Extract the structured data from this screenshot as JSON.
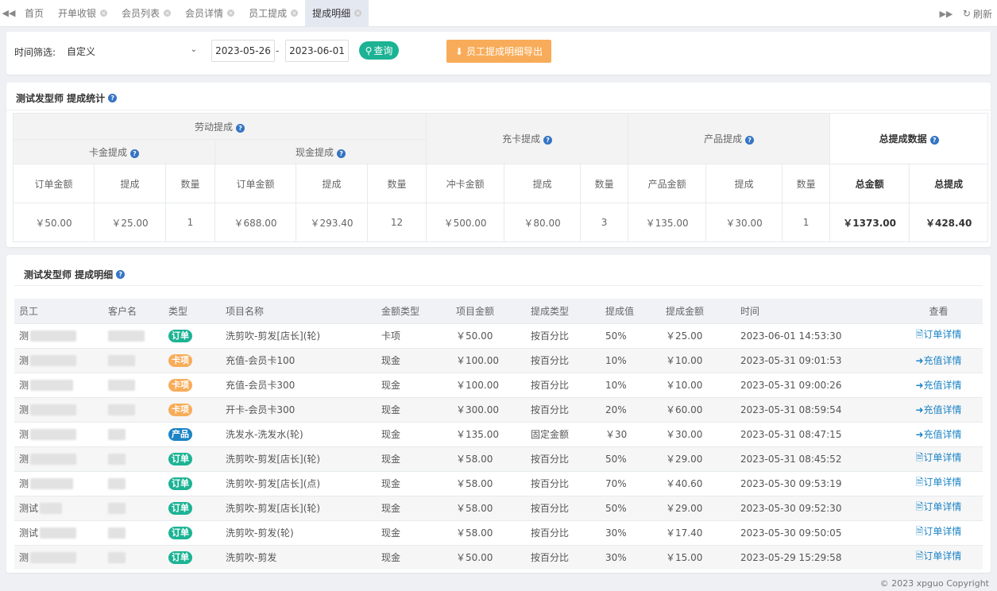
{
  "tabs": {
    "items": [
      {
        "label": "首页",
        "closable": false
      },
      {
        "label": "开单收银",
        "closable": true
      },
      {
        "label": "会员列表",
        "closable": true
      },
      {
        "label": "会员详情",
        "closable": true
      },
      {
        "label": "员工提成",
        "closable": true
      },
      {
        "label": "提成明细",
        "closable": true,
        "active": true
      }
    ],
    "refresh_label": "刷新"
  },
  "filter": {
    "label": "时间筛选:",
    "select_value": "自定义",
    "start_date": "2023-05-26",
    "separator": "-",
    "end_date": "2023-06-01",
    "query_label": "查询",
    "export_label": "员工提成明细导出"
  },
  "stats": {
    "title": "测试发型师 提成统计",
    "groups": {
      "labor": "劳动提成",
      "card_commission": "卡金提成",
      "cash_commission": "现金提成",
      "recharge": "充卡提成",
      "product": "产品提成",
      "total": "总提成数据"
    },
    "columns": [
      "订单金额",
      "提成",
      "数量",
      "订单金额",
      "提成",
      "数量",
      "冲卡金额",
      "提成",
      "数量",
      "产品金额",
      "提成",
      "数量",
      "总金额",
      "总提成"
    ],
    "values": [
      "￥50.00",
      "￥25.00",
      "1",
      "￥688.00",
      "￥293.40",
      "12",
      "￥500.00",
      "￥80.00",
      "3",
      "￥135.00",
      "￥30.00",
      "1",
      "￥1373.00",
      "￥428.40"
    ]
  },
  "detail": {
    "title": "测试发型师 提成明细",
    "headers": [
      "员工",
      "客户名",
      "类型",
      "项目名称",
      "金额类型",
      "项目金额",
      "提成类型",
      "提成值",
      "提成金额",
      "时间",
      "查看"
    ],
    "rows": [
      {
        "emp": "测",
        "type": "订单",
        "badge": "green",
        "item": "洗剪吹-剪发[店长](轮)",
        "amt_type": "卡项",
        "amount": "￥50.00",
        "comm_type": "按百分比",
        "comm_val": "50%",
        "comm_amt": "￥25.00",
        "time": "2023-06-01 14:53:30",
        "view": "订单详情",
        "view_icon": "document-icon"
      },
      {
        "emp": "测",
        "type": "卡项",
        "badge": "orange",
        "item": "充值-会员卡100",
        "amt_type": "现金",
        "amount": "￥100.00",
        "comm_type": "按百分比",
        "comm_val": "10%",
        "comm_amt": "￥10.00",
        "time": "2023-05-31 09:01:53",
        "view": "充值详情",
        "view_icon": "sign-in-icon"
      },
      {
        "emp": "测",
        "type": "卡项",
        "badge": "orange",
        "item": "充值-会员卡300",
        "amt_type": "现金",
        "amount": "￥100.00",
        "comm_type": "按百分比",
        "comm_val": "10%",
        "comm_amt": "￥10.00",
        "time": "2023-05-31 09:00:26",
        "view": "充值详情",
        "view_icon": "sign-in-icon"
      },
      {
        "emp": "测",
        "type": "卡项",
        "badge": "orange",
        "item": "开卡-会员卡300",
        "amt_type": "现金",
        "amount": "￥300.00",
        "comm_type": "按百分比",
        "comm_val": "20%",
        "comm_amt": "￥60.00",
        "time": "2023-05-31 08:59:54",
        "view": "充值详情",
        "view_icon": "sign-in-icon"
      },
      {
        "emp": "测",
        "type": "产品",
        "badge": "blue",
        "item": "洗发水-洗发水(轮)",
        "amt_type": "现金",
        "amount": "￥135.00",
        "comm_type": "固定金额",
        "comm_val": "￥30",
        "comm_amt": "￥30.00",
        "time": "2023-05-31 08:47:15",
        "view": "充值详情",
        "view_icon": "sign-in-icon"
      },
      {
        "emp": "测",
        "type": "订单",
        "badge": "green",
        "item": "洗剪吹-剪发[店长](轮)",
        "amt_type": "现金",
        "amount": "￥58.00",
        "comm_type": "按百分比",
        "comm_val": "50%",
        "comm_amt": "￥29.00",
        "time": "2023-05-31 08:45:52",
        "view": "订单详情",
        "view_icon": "document-icon"
      },
      {
        "emp": "测",
        "type": "订单",
        "badge": "green",
        "item": "洗剪吹-剪发[店长](点)",
        "amt_type": "现金",
        "amount": "￥58.00",
        "comm_type": "按百分比",
        "comm_val": "70%",
        "comm_amt": "￥40.60",
        "time": "2023-05-30 09:53:19",
        "view": "订单详情",
        "view_icon": "document-icon"
      },
      {
        "emp": "测试",
        "type": "订单",
        "badge": "green",
        "item": "洗剪吹-剪发[店长](轮)",
        "amt_type": "现金",
        "amount": "￥58.00",
        "comm_type": "按百分比",
        "comm_val": "50%",
        "comm_amt": "￥29.00",
        "time": "2023-05-30 09:52:30",
        "view": "订单详情",
        "view_icon": "document-icon"
      },
      {
        "emp": "测试",
        "type": "订单",
        "badge": "green",
        "item": "洗剪吹-剪发(轮)",
        "amt_type": "现金",
        "amount": "￥58.00",
        "comm_type": "按百分比",
        "comm_val": "30%",
        "comm_amt": "￥17.40",
        "time": "2023-05-30 09:50:05",
        "view": "订单详情",
        "view_icon": "document-icon"
      },
      {
        "emp": "测",
        "type": "订单",
        "badge": "green",
        "item": "洗剪吹-剪发",
        "amt_type": "现金",
        "amount": "￥50.00",
        "comm_type": "按百分比",
        "comm_val": "30%",
        "comm_amt": "￥15.00",
        "time": "2023-05-29 15:29:58",
        "view": "订单详情",
        "view_icon": "document-icon"
      }
    ]
  },
  "footer": {
    "copyright": "© 2023 xpguo Copyright"
  },
  "colors": {
    "green": "#1cb394",
    "orange": "#f8ac59",
    "blue": "#1c84c6"
  }
}
